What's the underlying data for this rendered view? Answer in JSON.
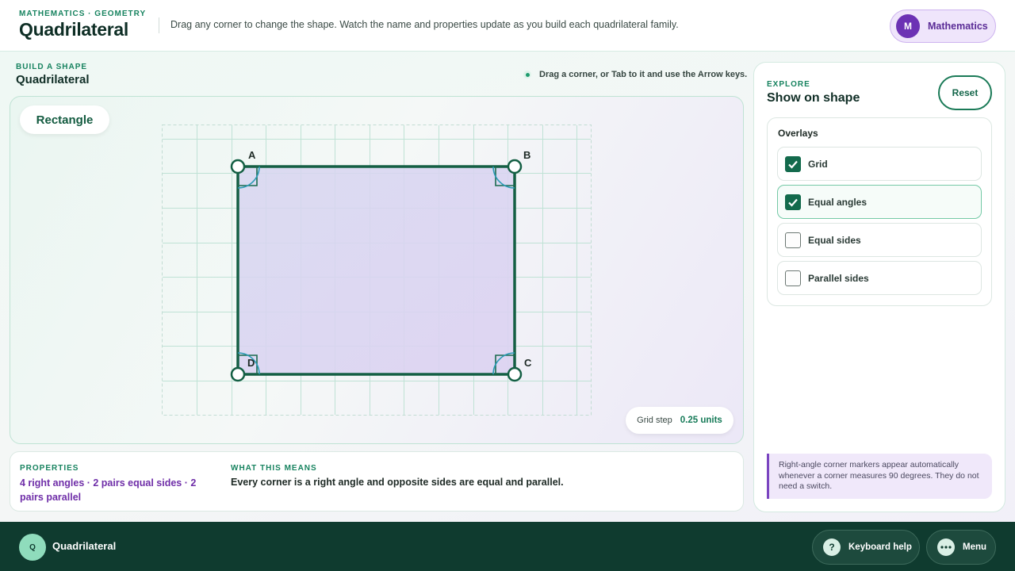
{
  "header": {
    "eyebrow": "MATHEMATICS · GEOMETRY",
    "title": "Quadrilateral",
    "description": "Drag any corner to change the shape. Watch the name and properties update as you build each quadrilateral family.",
    "subject": {
      "avatar": "M",
      "label": "Mathematics"
    }
  },
  "build": {
    "eyebrow": "BUILD A SHAPE",
    "title": "Quadrilateral",
    "hint": "Drag a corner, or Tab to it and use the Arrow keys.",
    "shape_name": "Rectangle",
    "corners": [
      "A",
      "B",
      "C",
      "D"
    ],
    "grid_step_label": "Grid step",
    "grid_step_value": "0.25 units"
  },
  "properties": {
    "label": "PROPERTIES",
    "value": "4 right angles · 2 pairs equal sides · 2 pairs parallel",
    "means_label": "WHAT THIS MEANS",
    "means_value": "Every corner is a right angle and opposite sides are equal and parallel."
  },
  "panel": {
    "eyebrow": "EXPLORE",
    "title": "Show on shape",
    "reset_label": "Reset",
    "overlays_label": "Overlays",
    "options": [
      {
        "label": "Grid",
        "checked": true
      },
      {
        "label": "Equal angles",
        "checked": true
      },
      {
        "label": "Equal sides",
        "checked": false
      },
      {
        "label": "Parallel sides",
        "checked": false
      }
    ],
    "note": "Right-angle corner markers appear automatically whenever a corner measures 90 degrees. They do not need a switch."
  },
  "footer": {
    "badge": "Q",
    "title": "Quadrilateral",
    "keyboard_help": "Keyboard help",
    "keyboard_icon": "?",
    "menu": "Menu"
  },
  "colors": {
    "accent_green": "#136a4c",
    "shape_fill": "#ddd4f1",
    "accent_purple": "#6f2ea8",
    "footer_bg": "#0f3b2f"
  },
  "icons": [
    "help-icon",
    "more-icon",
    "check-icon"
  ]
}
